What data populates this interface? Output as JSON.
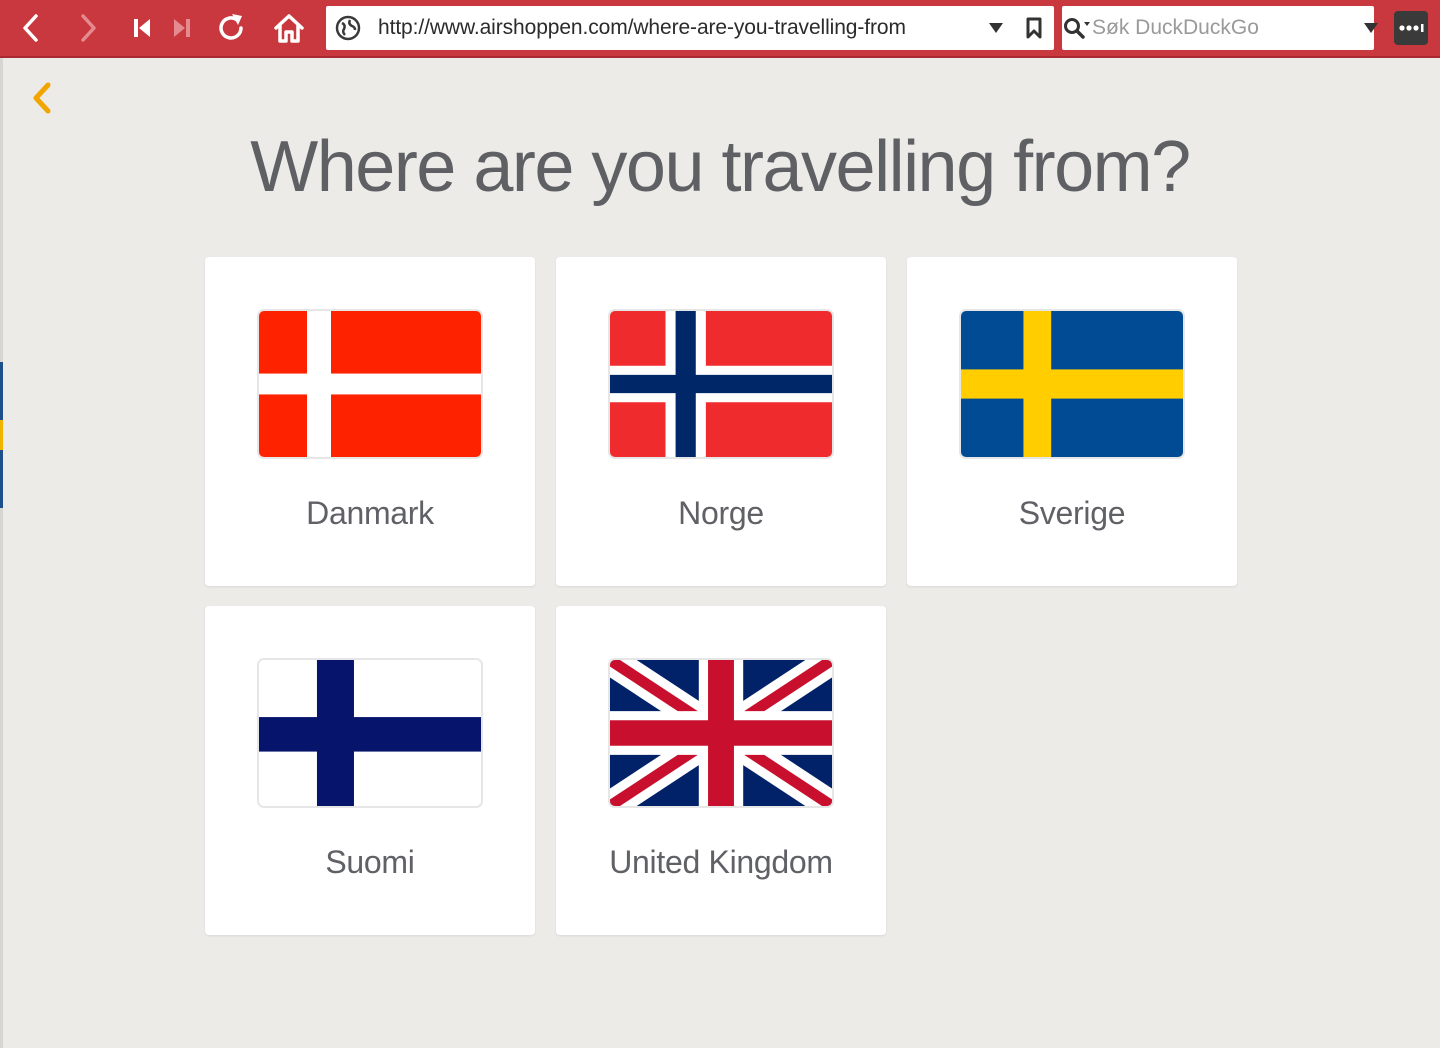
{
  "browser": {
    "url": "http://www.airshoppen.com/where-are-you-travelling-from",
    "search_placeholder": "Søk DuckDuckGo",
    "accent_color": "#c9383f"
  },
  "page": {
    "title": "Where are you travelling from?",
    "accent_color": "#f0a500"
  },
  "countries": [
    {
      "label": "Danmark",
      "flag": "denmark-flag"
    },
    {
      "label": "Norge",
      "flag": "norway-flag"
    },
    {
      "label": "Sverige",
      "flag": "sweden-flag"
    },
    {
      "label": "Suomi",
      "flag": "finland-flag"
    },
    {
      "label": "United Kingdom",
      "flag": "uk-flag"
    }
  ]
}
